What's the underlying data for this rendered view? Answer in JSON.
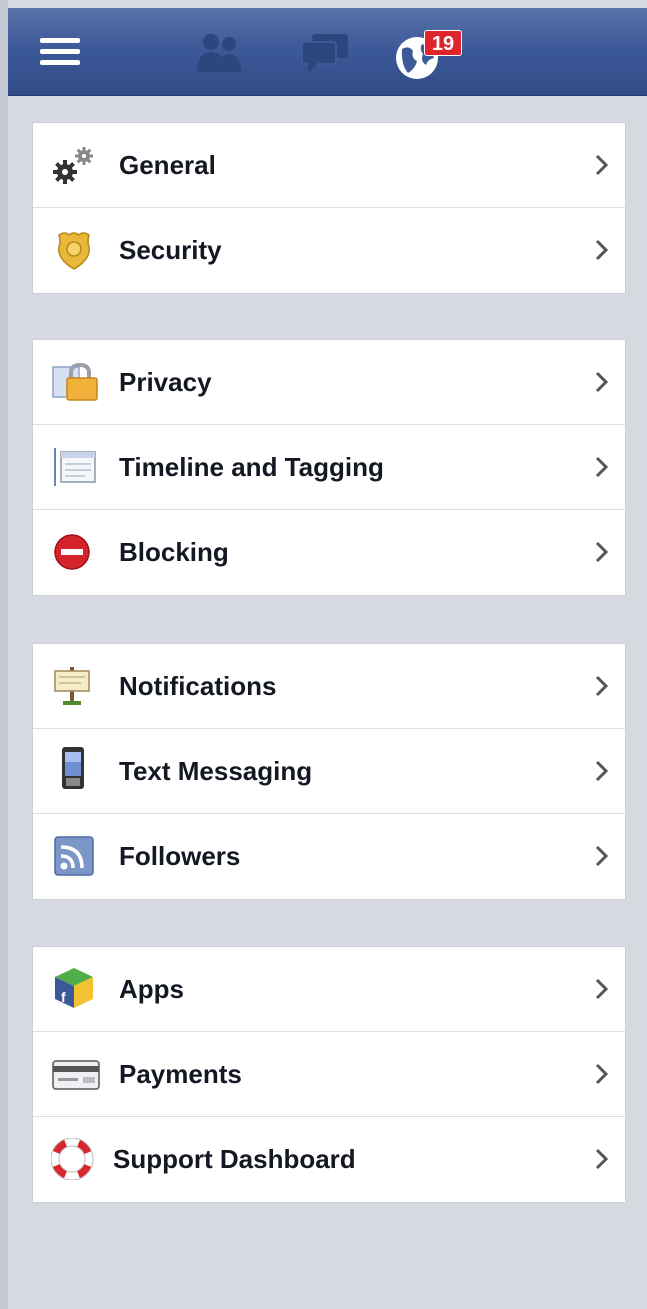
{
  "header": {
    "menu_icon": "hamburger-menu-icon",
    "friend_requests_icon": "friends-icon",
    "messages_icon": "messages-icon",
    "notifications_icon": "globe-icon",
    "notifications_count": "19",
    "colors": {
      "bar": "#3d5a98",
      "badge": "#e0242b"
    }
  },
  "groups": [
    {
      "items": [
        {
          "label": "General",
          "icon": "gears-icon"
        },
        {
          "label": "Security",
          "icon": "badge-shield-icon"
        }
      ]
    },
    {
      "items": [
        {
          "label": "Privacy",
          "icon": "padlock-icon"
        },
        {
          "label": "Timeline and Tagging",
          "icon": "timeline-icon"
        },
        {
          "label": "Blocking",
          "icon": "no-entry-icon"
        }
      ]
    },
    {
      "items": [
        {
          "label": "Notifications",
          "icon": "signpost-icon"
        },
        {
          "label": "Text Messaging",
          "icon": "mobile-phone-icon"
        },
        {
          "label": "Followers",
          "icon": "rss-feed-icon"
        }
      ]
    },
    {
      "items": [
        {
          "label": "Apps",
          "icon": "app-cube-icon"
        },
        {
          "label": "Payments",
          "icon": "credit-card-icon"
        },
        {
          "label": "Support Dashboard",
          "icon": "lifebuoy-icon"
        }
      ]
    }
  ]
}
